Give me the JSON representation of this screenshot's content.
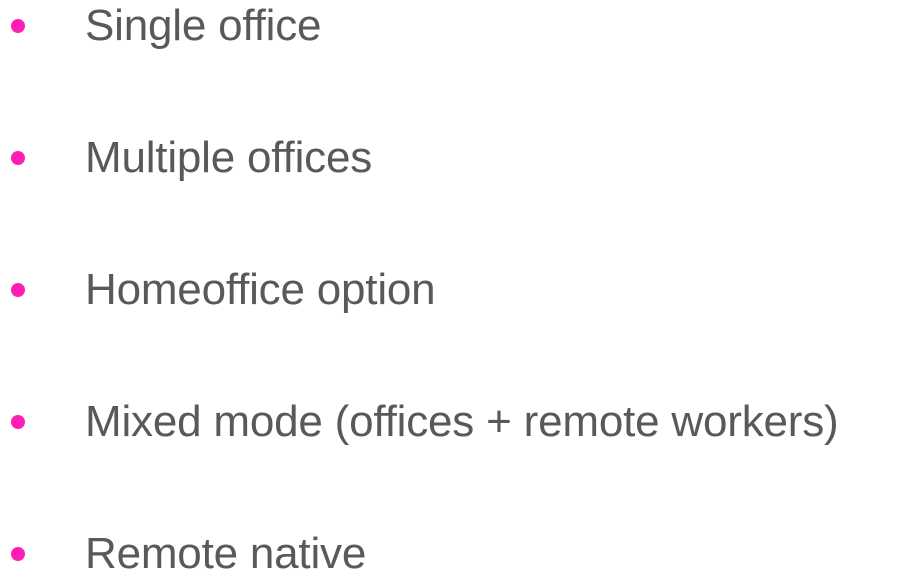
{
  "colors": {
    "bullet": "#ff1fb4",
    "text": "#595959",
    "background": "#ffffff"
  },
  "list": {
    "items": [
      {
        "label": "Single office"
      },
      {
        "label": "Multiple offices"
      },
      {
        "label": "Homeoffice option"
      },
      {
        "label": "Mixed mode (offices + remote workers)"
      },
      {
        "label": "Remote native"
      }
    ]
  }
}
